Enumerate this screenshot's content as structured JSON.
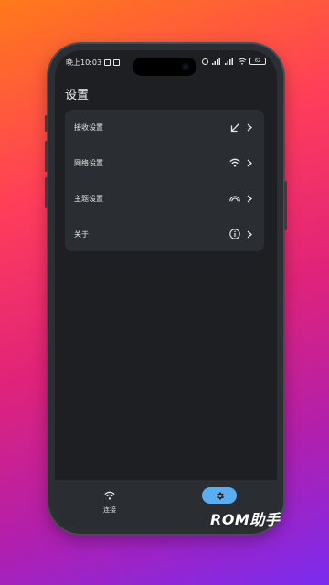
{
  "statusbar": {
    "time": "晚上10:03",
    "battery": "62"
  },
  "page": {
    "title": "设置"
  },
  "settings": {
    "items": [
      {
        "label": "接收设置",
        "icon": "arrow-down-left-icon"
      },
      {
        "label": "网络设置",
        "icon": "wifi-icon"
      },
      {
        "label": "主题设置",
        "icon": "rainbow-icon"
      },
      {
        "label": "关于",
        "icon": "info-icon"
      }
    ]
  },
  "navbar": {
    "items": [
      {
        "label": "连接",
        "icon": "wifi-icon",
        "active": false
      },
      {
        "label": "",
        "icon": "gear-icon",
        "active": true
      }
    ]
  },
  "colors": {
    "accent": "#5aaef0",
    "screen_bg": "#1d1f22",
    "card_bg": "#2a2d31"
  },
  "watermark": {
    "text": "ROM助手"
  }
}
